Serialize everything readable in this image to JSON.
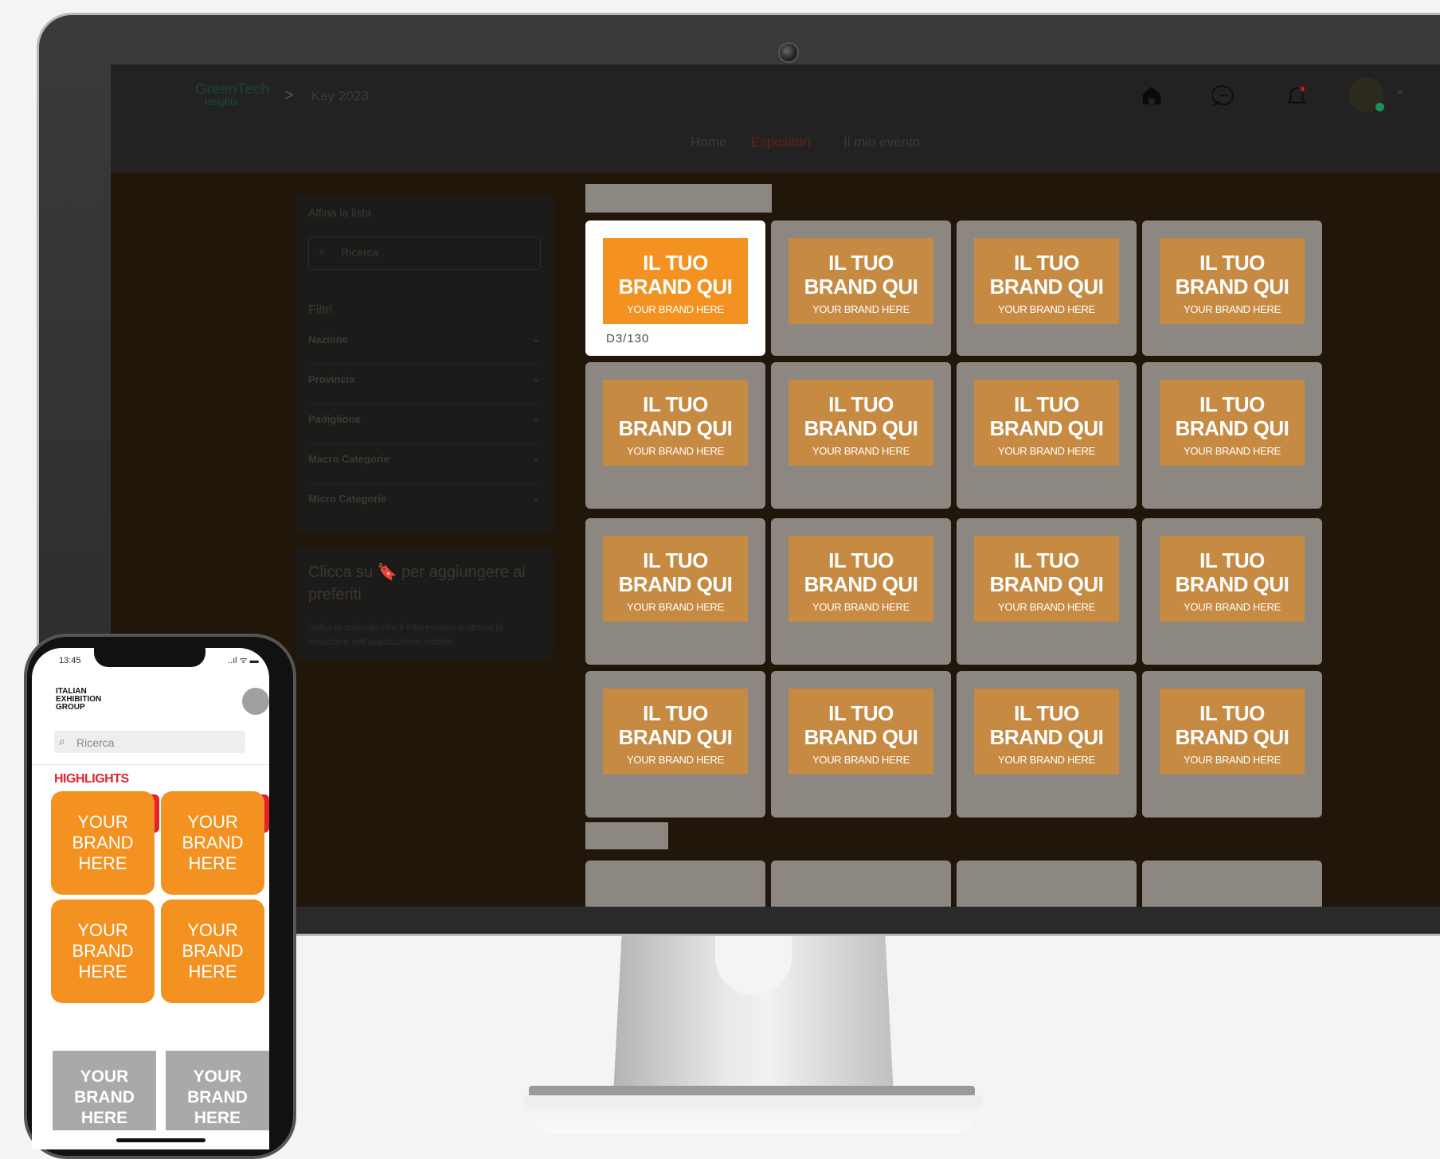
{
  "header": {
    "logo_line1": "GreenTech",
    "logo_line2": "Insights",
    "breadcrumb_separator": ">",
    "event_name": "Key 2023",
    "notification_count": "0",
    "avatar_chevron": "⌄"
  },
  "nav": {
    "home": "Home",
    "exhibitors": "Espositori",
    "my_event": "Il mio evento"
  },
  "sidebar": {
    "title": "Affina la lista",
    "search_icon": "search-icon",
    "search_placeholder": "Ricerca",
    "filters_title": "Filtri",
    "filters": [
      {
        "label": "Nazione"
      },
      {
        "label": "Provincia"
      },
      {
        "label": "Padiglione"
      },
      {
        "label": "Macro Categorie"
      },
      {
        "label": "Micro Categorie"
      }
    ]
  },
  "favorites": {
    "title": "Clicca su 🔖 per aggiungere ai preferiti",
    "subtitle": "Salva le aziende che ti interessano e ritrova la selezione nell'applicazione mobile."
  },
  "grid": {
    "brand_line1": "IL TUO",
    "brand_line2": "BRAND QUI",
    "brand_sub": "YOUR BRAND HERE",
    "active_stand": "D3/130",
    "rows": 4,
    "cols": 4,
    "colors": {
      "active_logo": "#f39121",
      "dim_logo": "#c78a43",
      "tile": "#8d8781"
    }
  },
  "phone": {
    "time": "13:45",
    "status": "..ıl ᯤ ▬",
    "logo": "ITALIAN EXHIBITION GROUP",
    "search_placeholder": "Ricerca",
    "highlights": "HIGHLIGHTS",
    "card_text": "YOUR BRAND HERE",
    "grey_card_text": "YOUR BRAND HERE",
    "accent": "#e3222b",
    "card_color": "#f39121"
  }
}
